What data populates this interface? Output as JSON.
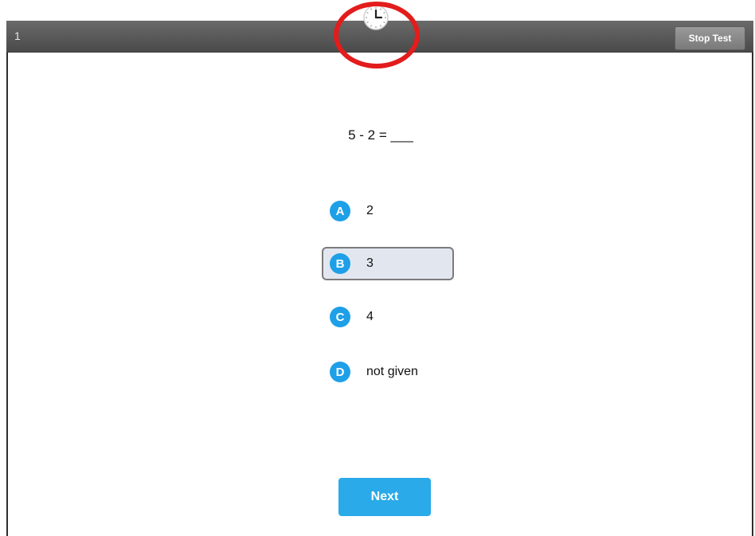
{
  "header": {
    "question_number": "1",
    "stop_test_label": "Stop Test",
    "timer_icon": "clock-icon",
    "highlight_color": "#e31c1c"
  },
  "question": {
    "text": "5 - 2 = ___"
  },
  "options": [
    {
      "letter": "A",
      "text": "2",
      "selected": false
    },
    {
      "letter": "B",
      "text": "3",
      "selected": true
    },
    {
      "letter": "C",
      "text": "4",
      "selected": false
    },
    {
      "letter": "D",
      "text": "not given",
      "selected": false
    }
  ],
  "footer": {
    "next_label": "Next"
  },
  "colors": {
    "accent": "#2aaae8",
    "badge": "#1ea0e8",
    "topbar": "#555555",
    "selected_bg": "#e2e7ef"
  }
}
